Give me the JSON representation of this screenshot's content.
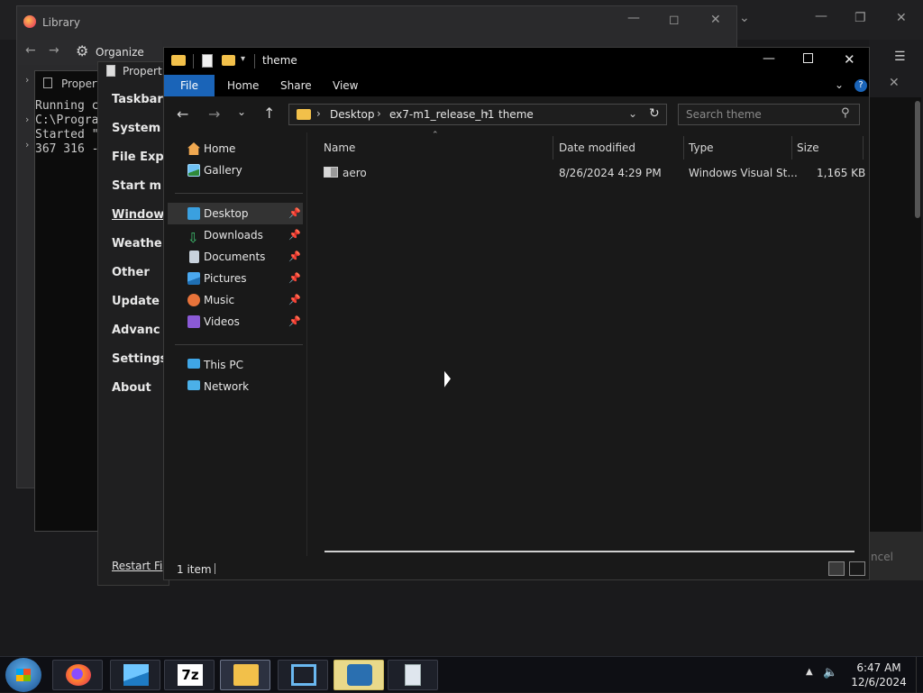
{
  "background": {
    "library_title": "Library",
    "library_organize": "Organize",
    "cmd_title": "Propert",
    "cmd_lines": [
      "Running c",
      "C:\\Progra",
      "Started \"",
      "367 316 -"
    ],
    "props_title": "Propert",
    "props_items": [
      "Taskbar",
      "System",
      "File Exp",
      "Start m",
      "Window",
      "Weathe",
      "Other",
      "Update",
      "Advanc",
      "Settings",
      "About"
    ],
    "props_link": "Restart Fi",
    "right_cancel": "ncel"
  },
  "explorer": {
    "title": "theme",
    "tabs": [
      "File",
      "Home",
      "Share",
      "View"
    ],
    "breadcrumb": [
      "Desktop",
      "ex7-m1_release_h1",
      "theme"
    ],
    "search_placeholder": "Search theme",
    "nav_quick": [
      {
        "label": "Home",
        "icon": "home-icon",
        "pinned": false
      },
      {
        "label": "Gallery",
        "icon": "gallery-icon",
        "pinned": false
      }
    ],
    "nav_pinned": [
      {
        "label": "Desktop",
        "icon": "desktop-icon",
        "pinned": true
      },
      {
        "label": "Downloads",
        "icon": "download-icon",
        "pinned": true
      },
      {
        "label": "Documents",
        "icon": "documents-icon",
        "pinned": true
      },
      {
        "label": "Pictures",
        "icon": "pictures-icon",
        "pinned": true
      },
      {
        "label": "Music",
        "icon": "music-icon",
        "pinned": true
      },
      {
        "label": "Videos",
        "icon": "videos-icon",
        "pinned": true
      }
    ],
    "nav_other": [
      {
        "label": "This PC",
        "icon": "computer-icon"
      },
      {
        "label": "Network",
        "icon": "network-icon"
      }
    ],
    "columns": [
      "Name",
      "Date modified",
      "Type",
      "Size"
    ],
    "rows": [
      {
        "name": "aero",
        "date": "8/26/2024 4:29 PM",
        "type": "Windows Visual St...",
        "size": "1,165 KB"
      }
    ],
    "status": "1 item"
  },
  "taskbar": {
    "time": "6:47 AM",
    "date": "12/6/2024",
    "apps": [
      "firefox-icon",
      "photos-icon",
      "7zip-icon",
      "file-explorer-icon",
      "remote-desktop-icon",
      "media-icon",
      "properties-icon"
    ]
  },
  "colors": {
    "accent": "#1a64b8",
    "selected_nav": "#333333",
    "folder": "#f2c04a"
  }
}
